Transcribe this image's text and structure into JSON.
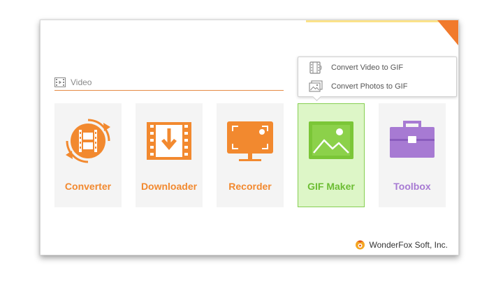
{
  "section": {
    "label": "Video"
  },
  "cards": [
    {
      "id": "converter",
      "label": "Converter",
      "icon": "converter-icon"
    },
    {
      "id": "downloader",
      "label": "Downloader",
      "icon": "download-icon"
    },
    {
      "id": "recorder",
      "label": "Recorder",
      "icon": "screen-record-icon"
    },
    {
      "id": "gif-maker",
      "label": "GIF Maker",
      "icon": "image-icon",
      "selected": true
    },
    {
      "id": "toolbox",
      "label": "Toolbox",
      "icon": "toolbox-icon"
    }
  ],
  "gif_menu": [
    {
      "label": "Convert Video to GIF",
      "icon": "film-strip-icon"
    },
    {
      "label": "Convert Photos to GIF",
      "icon": "photos-icon"
    }
  ],
  "footer": {
    "brand": "WonderFox Soft, Inc."
  },
  "colors": {
    "accent": "#f2892f",
    "gif_green": "#6cbd33",
    "toolbox_purple": "#a77ad3",
    "card_bg": "#f4f4f4"
  }
}
